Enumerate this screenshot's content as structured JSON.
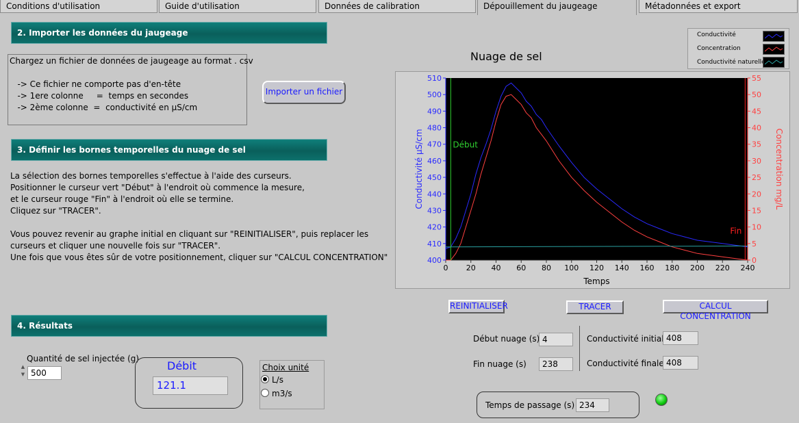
{
  "tabs": [
    {
      "label": "Conditions d'utilisation"
    },
    {
      "label": "Guide d'utilisation"
    },
    {
      "label": "Données de calibration"
    },
    {
      "label": "Dépouillement du jaugeage"
    },
    {
      "label": "Métadonnées et export"
    }
  ],
  "sections": {
    "import": "2. Importer les données du jaugeage",
    "bounds": "3. Définir les bornes temporelles du nuage de sel",
    "results": "4. Résultats"
  },
  "import_box": {
    "line1": "Chargez un fichier de données de jaugeage au format . csv",
    "line2": "   -> Ce fichier ne comporte pas d'en-tête",
    "line3": "   -> 1ere colonne     =  temps en secondes",
    "line4": "   -> 2ème colonne  =  conductivité en µS/cm"
  },
  "import_button": "Importer un fichier",
  "bounds_text": {
    "l1": "La sélection des bornes temporelles s'effectue à l'aide des curseurs.",
    "l2": "Positionner le curseur vert \"Début\" à l'endroit où commence la mesure,",
    "l3": "et le curseur rouge \"Fin\" à l'endroit où elle se termine.",
    "l4": "Cliquez sur \"TRACER\".",
    "l5": "Vous pouvez revenir au graphe initial en cliquant sur \"REINITIALISER\", puis replacer les",
    "l6": "curseurs et cliquer une nouvelle fois sur \"TRACER\".",
    "l7": "Une fois que vous êtes sûr de votre positionnement, cliquer sur \"CALCUL CONCENTRATION\""
  },
  "legend": [
    "Conductivité",
    "Concentration",
    "Conductivité naturelle"
  ],
  "buttons": {
    "reset": "REINITIALISER",
    "trace": "TRACER",
    "calc": "CALCUL CONCENTRATION"
  },
  "fields": {
    "debut_label": "Début nuage (s)",
    "debut_value": "4",
    "fin_label": "Fin nuage (s)",
    "fin_value": "238",
    "cond_init_label": "Conductivité initiale",
    "cond_init_value": "408",
    "cond_fin_label": "Conductivité finale",
    "cond_fin_value": "408",
    "passage_label": "Temps de passage (s)",
    "passage_value": "234"
  },
  "results": {
    "salt_label": "Quantité de sel injectée (g)",
    "salt_value": "500",
    "debit_label": "Débit",
    "debit_value": "121.1",
    "unit_label": "Choix unité",
    "unit_ls": "L/s",
    "unit_m3s": "m3/s"
  },
  "colors": {
    "conductivity": "#2a2aff",
    "concentration": "#ff4040",
    "natural": "#2aa0a0",
    "cursor_start": "#30d030",
    "cursor_end": "#ff2020"
  },
  "chart_data": {
    "type": "line",
    "title": "Nuage de sel",
    "xlabel": "Temps",
    "ylabel_left": "Conductivité µS/cm",
    "ylabel_right": "Concentration mg/L",
    "xlim": [
      0,
      240
    ],
    "ylim_left": [
      400,
      510
    ],
    "ylim_right": [
      0,
      55
    ],
    "x_ticks": [
      0,
      20,
      40,
      60,
      80,
      100,
      120,
      140,
      160,
      180,
      200,
      220,
      240
    ],
    "y_left_ticks": [
      400,
      410,
      420,
      430,
      440,
      450,
      460,
      470,
      480,
      490,
      500,
      510
    ],
    "y_right_ticks": [
      0,
      5,
      10,
      15,
      20,
      25,
      30,
      35,
      40,
      45,
      50,
      55
    ],
    "cursor_start": {
      "label": "Début",
      "x": 4
    },
    "cursor_end": {
      "label": "Fin",
      "x": 238
    },
    "series": [
      {
        "name": "Conductivité",
        "axis": "left",
        "x": [
          0,
          4,
          8,
          12,
          16,
          20,
          24,
          28,
          32,
          36,
          40,
          44,
          48,
          52,
          56,
          60,
          64,
          68,
          72,
          76,
          80,
          90,
          100,
          110,
          120,
          130,
          140,
          150,
          160,
          170,
          180,
          190,
          200,
          210,
          220,
          230,
          240
        ],
        "y": [
          407,
          408,
          413,
          420,
          430,
          440,
          452,
          462,
          470,
          479,
          490,
          499,
          505,
          507,
          504,
          501,
          496,
          493,
          488,
          485,
          480,
          469,
          459,
          450,
          443,
          437,
          431,
          426,
          422,
          419,
          416,
          414,
          412,
          411,
          410,
          409,
          408
        ]
      },
      {
        "name": "Concentration",
        "axis": "right",
        "x": [
          0,
          4,
          8,
          12,
          16,
          20,
          24,
          28,
          32,
          36,
          40,
          44,
          48,
          52,
          56,
          60,
          64,
          68,
          72,
          76,
          80,
          90,
          100,
          110,
          120,
          130,
          140,
          150,
          160,
          170,
          180,
          190,
          200,
          210,
          220,
          230,
          240
        ],
        "y": [
          0,
          0,
          2,
          5,
          10,
          15,
          20,
          26,
          31,
          36,
          42,
          47,
          49.5,
          50,
          48.5,
          47,
          44.5,
          43,
          40,
          38,
          36,
          30,
          25,
          21,
          17.5,
          14.5,
          11.5,
          9,
          7,
          5.5,
          4,
          3,
          2,
          1.5,
          1,
          0.5,
          0
        ]
      },
      {
        "name": "Conductivité naturelle",
        "axis": "left",
        "x": [
          0,
          240
        ],
        "y": [
          408,
          408.5
        ]
      }
    ]
  }
}
